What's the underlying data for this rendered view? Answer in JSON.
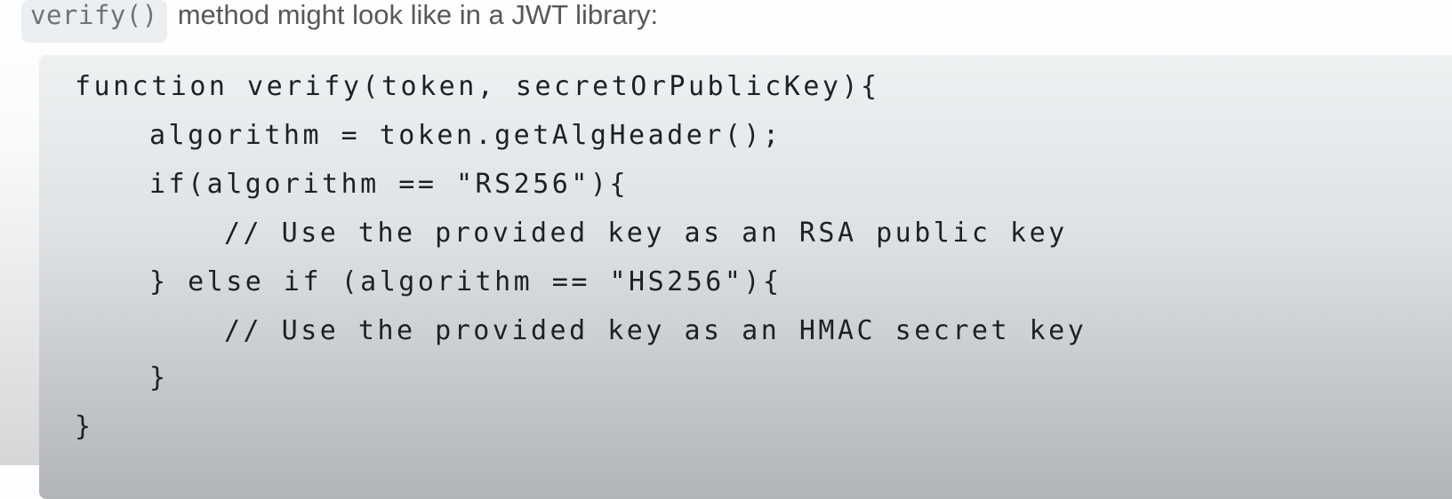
{
  "intro": {
    "inline_code": "verify()",
    "text": "method might look like in a JWT library:"
  },
  "code": {
    "lines": [
      "function verify(token, secretOrPublicKey){",
      "algorithm = token.getAlgHeader();",
      "if(algorithm == \"RS256\"){",
      "// Use the provided key as an RSA public key",
      "} else if (algorithm == \"HS256\"){",
      "// Use the provided key as an HMAC secret key",
      "}",
      "}"
    ]
  }
}
